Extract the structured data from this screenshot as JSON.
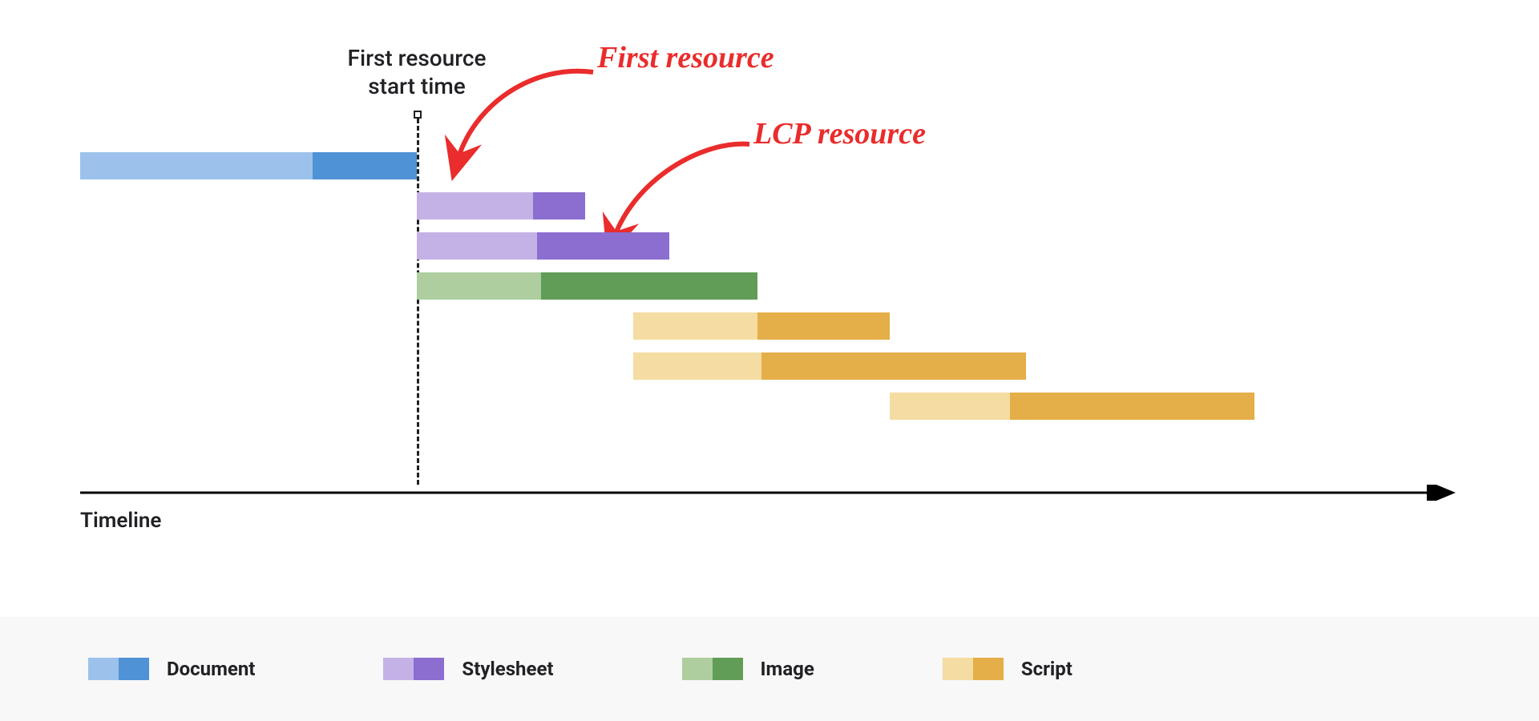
{
  "chart_data": {
    "type": "bar",
    "title": "",
    "xlabel": "Timeline",
    "ylabel": "",
    "marker": {
      "label": "First resource\nstart time",
      "x": 420
    },
    "annotations": [
      {
        "text": "First resource",
        "target": "stylesheet-1"
      },
      {
        "text": "LCP resource",
        "target": "image-1"
      }
    ],
    "series": [
      {
        "name": "Document",
        "light": "#9cc2ec",
        "dark": "#4f92d5",
        "bars": [
          {
            "start": 0,
            "light_w": 290,
            "dark_w": 130
          }
        ]
      },
      {
        "name": "Stylesheet",
        "light": "#c4b2e6",
        "dark": "#8b6ecf",
        "bars": [
          {
            "start": 420,
            "light_w": 145,
            "dark_w": 65
          },
          {
            "start": 420,
            "light_w": 150,
            "dark_w": 165
          }
        ]
      },
      {
        "name": "Image",
        "light": "#aecea0",
        "dark": "#629d57",
        "bars": [
          {
            "start": 420,
            "light_w": 155,
            "dark_w": 270
          }
        ]
      },
      {
        "name": "Script",
        "light": "#f4dca2",
        "dark": "#e4ae48",
        "bars": [
          {
            "start": 690,
            "light_w": 155,
            "dark_w": 165
          },
          {
            "start": 690,
            "light_w": 160,
            "dark_w": 330
          },
          {
            "start": 1010,
            "light_w": 150,
            "dark_w": 305
          }
        ]
      }
    ],
    "legend": [
      {
        "label": "Document",
        "light": "#9cc2ec",
        "dark": "#4f92d5"
      },
      {
        "label": "Stylesheet",
        "light": "#c4b2e6",
        "dark": "#8b6ecf"
      },
      {
        "label": "Image",
        "light": "#aecea0",
        "dark": "#629d57"
      },
      {
        "label": "Script",
        "light": "#f4dca2",
        "dark": "#e4ae48"
      }
    ]
  }
}
